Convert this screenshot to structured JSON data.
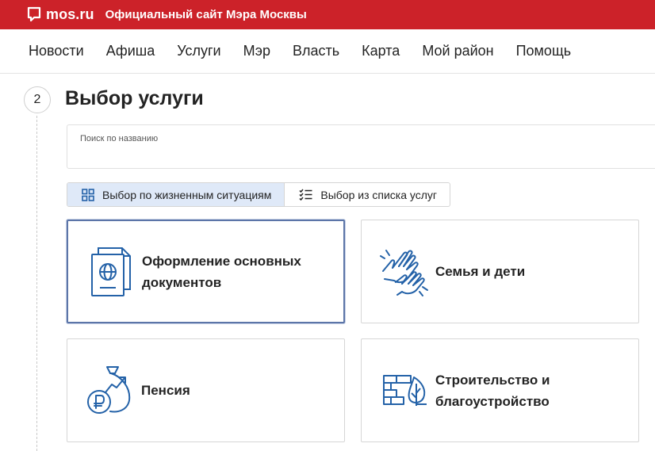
{
  "header": {
    "brand": "mos.ru",
    "site_title": "Официальный сайт Мэра Москвы",
    "accent_color": "#cc2229",
    "logo_icon": "speech-bubble-icon"
  },
  "nav": {
    "items": [
      {
        "label": "Новости"
      },
      {
        "label": "Афиша"
      },
      {
        "label": "Услуги"
      },
      {
        "label": "Мэр"
      },
      {
        "label": "Власть"
      },
      {
        "label": "Карта"
      },
      {
        "label": "Мой район"
      },
      {
        "label": "Помощь"
      }
    ]
  },
  "step": {
    "number": "2",
    "title": "Выбор услуги"
  },
  "search": {
    "label": "Поиск по названию",
    "value": ""
  },
  "view_toggle": {
    "options": [
      {
        "label": "Выбор по жизненным ситуациям",
        "icon": "grid-icon",
        "active": true
      },
      {
        "label": "Выбор из списка услуг",
        "icon": "checklist-icon",
        "active": false
      }
    ]
  },
  "categories": [
    {
      "label": "Оформление основных документов",
      "icon": "passport-icon",
      "selected": true
    },
    {
      "label": "Семья и дети",
      "icon": "hands-icon",
      "selected": false
    },
    {
      "label": "Пенсия",
      "icon": "money-bag-icon",
      "selected": false
    },
    {
      "label": "Строительство и благоустройство",
      "icon": "brick-wall-leaf-icon",
      "selected": false
    }
  ],
  "icon_color": "#2462a8"
}
